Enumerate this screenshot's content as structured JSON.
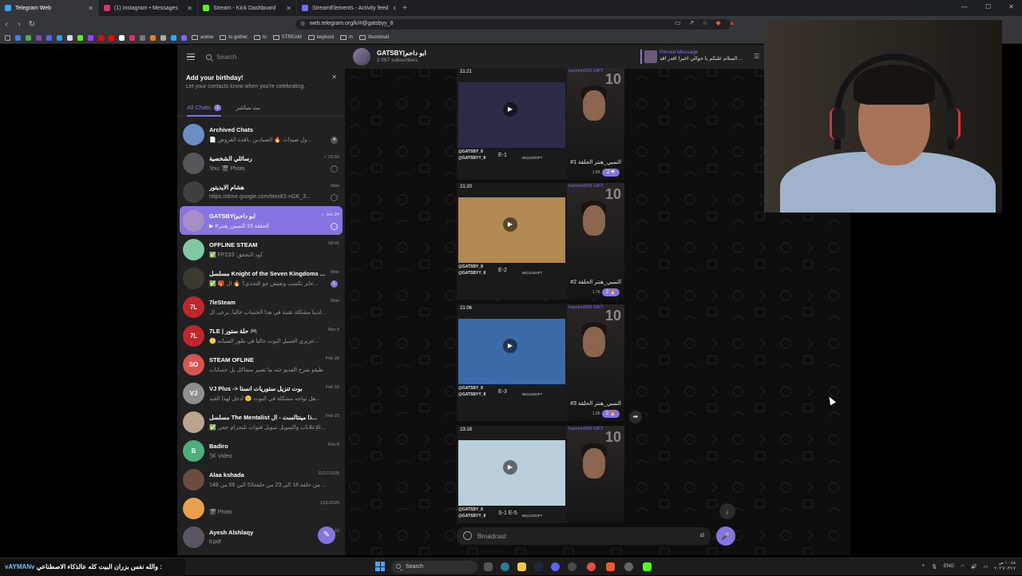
{
  "browser": {
    "tabs": [
      {
        "title": "Telegram Web",
        "color": "#2aabee",
        "active": true
      },
      {
        "title": "(1) Instagram • Messages",
        "color": "#e1306c",
        "active": false
      },
      {
        "title": "Stream - Kick Dashboard",
        "color": "#53fc18",
        "active": false
      },
      {
        "title": "StreamElements - Activity feed",
        "color": "#6f6fff",
        "active": false
      }
    ],
    "url": "web.telegram.org/k/#@gatsbyy_8",
    "bookmarks": [
      "anime",
      "to gother",
      "tv",
      "STREAM",
      "keybord",
      "m",
      "thumbnail"
    ]
  },
  "sidebar": {
    "search_placeholder": "Search",
    "birthday": {
      "title": "Add your birthday!",
      "subtitle": "Let your contacts know when you're celebrating."
    },
    "folders": [
      {
        "label": "All Chats",
        "badge": "1"
      },
      {
        "label": "بث مباشر"
      }
    ],
    "chats": [
      {
        "name": "Archived Chats",
        "time": "",
        "preview": "📄 ول صيدات 🔥 الصيادين ,نافذة العروض...",
        "badge": "4",
        "badge_style": "grey",
        "avatar": "#6a8fc7",
        "initials": ""
      },
      {
        "name": "رسائلي الشخصية",
        "time": "✓ 02:50",
        "preview": "You: 🎬 Photo",
        "pin": true,
        "avatar": "#56565a",
        "initials": ""
      },
      {
        "name": "هشام الايديتور",
        "time": "Mon",
        "preview": "https://drive.google.com/file/d/1-nGK_3...",
        "pin": true,
        "avatar": "#3f3f3f",
        "initials": ""
      },
      {
        "name": "GATSBY|ابو داحم",
        "time": "✓ Jan 24",
        "preview": "▶ #الحلقة 15 النمبي_هنتر",
        "pin": true,
        "active": true,
        "avatar": "#a78fc5",
        "initials": ""
      },
      {
        "name": "OFFLINE STEAM",
        "time": "08:05",
        "preview": "✅ FP233 :كود التحقق",
        "avatar": "#7ec8a4",
        "initials": ""
      },
      {
        "name": "مسلسل Knight of the Seven Kingdoms ...",
        "time": "Mon",
        "preview": "✅ 🎁 عايز تكسب وتعيش جو التحدي؟ 🔥 ال...",
        "badge": "1",
        "avatar": "#3c3a30",
        "initials": ""
      },
      {
        "name": "7leSteam",
        "time": "Mon",
        "preview": "لدينا مشكلة تقنية في هذا الحساب حالياً, يرجى ال...",
        "avatar": "#c0272d",
        "initials": "7L"
      },
      {
        "name": "7LE | حلة ستور 🎮",
        "time": "Mar 8",
        "preview": "🟡 عزيزي العميل البوت حالياً في طور الصيانه...",
        "avatar": "#c0272d",
        "initials": "7L"
      },
      {
        "name": "STEAM OFLINE",
        "time": "Feb 28",
        "preview": "طيقو شرح الفديو حته ما تصير مشاكل بل حسابات",
        "avatar": "#d9534f",
        "initials": "SO"
      },
      {
        "name": "VJ Plus -> بوت تنزيل ستوريات انستا",
        "time": "Feb 22",
        "preview": "هل تواجه مشكلة في البوت 😕 أدخل لهذا القيد...",
        "avatar": "#8f8f8f",
        "initials": "VJ"
      },
      {
        "name": "مسلسل The Mentalist ذا مينتالست - ال...",
        "time": "Feb 20",
        "preview": "✅ للإعلانات والتمويل تمويل قنوات تليجرام حقي...",
        "avatar": "#b9a58f",
        "initials": ""
      },
      {
        "name": "Badiro",
        "time": "Feb 9",
        "preview": "🛩 Video",
        "avatar": "#4caf7a",
        "initials": "B"
      },
      {
        "name": "Alaa kshada",
        "time": "11/17/2025",
        "preview": "من حلقة 18 الى 23 من حلقة53 الين 66 من 148 ...",
        "avatar": "#6d4c3d",
        "initials": ""
      },
      {
        "name": "",
        "time": "11/1/2025",
        "preview": "🎬 Photo",
        "avatar": "#e8a04a",
        "initials": ""
      },
      {
        "name": "Ayesh Alshlaqy",
        "time": "10",
        "preview": "ll.pdf",
        "avatar": "#5a5560",
        "initials": ""
      }
    ]
  },
  "channel": {
    "title": "GATSBY|ابو داحم",
    "subscribers": "2 057 subscribers",
    "pinned_label": "Pinned Message",
    "pinned_text": "السلام عليكم يا حوالي اخيرا اقدر اقد..."
  },
  "posts": [
    {
      "time": "21:21",
      "episode": "E-1",
      "title": "#النمبي_هنتر الحلقة 1",
      "views": "1.8K",
      "reaction": "2 ❤",
      "number": "10",
      "tag": "kaynien|505 GIFT",
      "scene": "#2b2b48"
    },
    {
      "time": "21:20",
      "episode": "E-2",
      "title": "#النمبي_هنتر الحلقة 2",
      "views": "1.7K",
      "reaction": "2 🔥",
      "number": "10",
      "tag": "kaynien|505 GIFT",
      "scene": "#b08a52"
    },
    {
      "time": "21:06",
      "episode": "E-3",
      "title": "#النمبي_هنتر الحلقة 3",
      "views": "1.9K",
      "reaction": "2 🔥",
      "number": "10",
      "tag": "kaynien|505 GIFT",
      "scene": "#3a6aa8"
    },
    {
      "time": "23:18",
      "episode": "S-1 E-5",
      "title": "",
      "views": "",
      "reaction": "",
      "number": "10",
      "tag": "kaynien|505 GIFT",
      "scene": "#b9cfdc"
    }
  ],
  "post_labels": {
    "watermark1": "@GATSBY_8",
    "watermark2": "@GATSBYY_8",
    "gift": "BK(163GIFT"
  },
  "composer": {
    "placeholder": "Broadcast"
  },
  "taskbar": {
    "ticker_name": "vAYMANv",
    "ticker_text": "والله نفس بزران البيت كله عالذكاء الاصطناعي :",
    "search": "Search",
    "lang": "ENG",
    "time": "١٠:٤٨ ص",
    "date": "٢٠٢٦/٠٣/١٧"
  }
}
